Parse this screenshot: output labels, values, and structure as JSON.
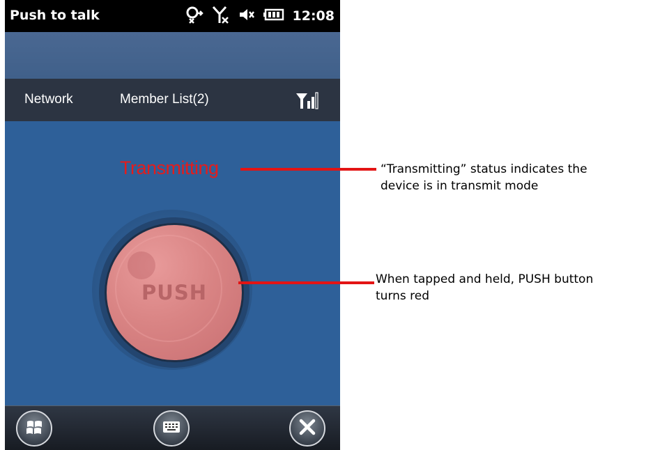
{
  "statusbar": {
    "title": "Push to talk",
    "time": "12:08",
    "icons": [
      "network-sharing-icon",
      "no-signal-icon",
      "speaker-muted-icon",
      "battery-icon"
    ]
  },
  "tabs": {
    "network": "Network",
    "member_list": "Member List(2)",
    "signal_icon": "signal-strength-icon"
  },
  "main": {
    "state": "Transmitting",
    "push_label": "PUSH",
    "push_color": "#d98484",
    "state_color": "#e41c1c"
  },
  "bottombar": {
    "start_icon": "windows-start-icon",
    "keyboard_icon": "keyboard-icon",
    "close_icon": "close-icon"
  },
  "annotations": {
    "transmitting_note_line1": "“Transmitting” status indicates the",
    "transmitting_note_line2": "device is in transmit mode",
    "push_note_line1": "When tapped and held, PUSH button",
    "push_note_line2": "turns red",
    "line_color": "#e31414"
  }
}
